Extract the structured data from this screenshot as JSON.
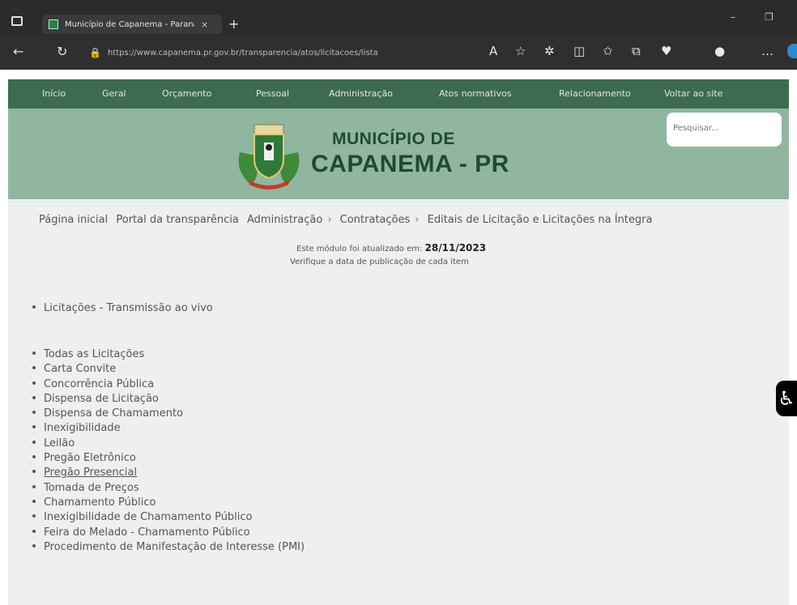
{
  "browser": {
    "tab_title": "Município de Capanema - Paraná",
    "tab_close": "×",
    "new_tab": "+",
    "url": "https://www.capanema.pr.gov.br/transparencia/atos/licitacoes/lista"
  },
  "site_nav": {
    "items": [
      "Início",
      "Geral",
      "Orçamento",
      "Pessoal",
      "Administração",
      "Atos normativos",
      "Relacionamento",
      "Voltar ao site"
    ]
  },
  "header": {
    "title_line1": "MUNICÍPIO DE",
    "title_line2": "CAPANEMA - PR",
    "search_placeholder": "Pesquisar..."
  },
  "breadcrumb": {
    "items": [
      "Página inicial",
      "Portal da transparência",
      "Administração",
      "Contratações",
      "Editais de Licitação e Licitações na Íntegra"
    ],
    "separator": "›"
  },
  "update_notice": {
    "prefix": "Este módulo foi atualizado em:",
    "date": "28/11/2023",
    "verify": "Verifique a data de publicação de cada item"
  },
  "live_list": [
    "Licitações - Transmissão ao vivo"
  ],
  "main_list": [
    "Todas as Licitações",
    "Carta Convite",
    "Concorrência Pública",
    "Dispensa de Licitação",
    "Dispensa de Chamamento",
    "Inexigibilidade",
    "Leilão",
    "Pregão Eletrônico",
    "Pregão Presencial",
    "Tomada de Preços",
    "Chamamento Público",
    "Inexigibilidade de Chamamento Público",
    "Feira do Melado - Chamamento Público",
    "Procedimento de Manifestação de Interesse (PMI)"
  ],
  "colors": {
    "nav_bg": "#3d6b4f",
    "header_bg": "#90b69f",
    "title": "#1f4a2d",
    "content_bg": "#edf0ef"
  },
  "icons": [
    "tabs-icon",
    "back-icon",
    "refresh-icon",
    "lock-icon",
    "read-aloud-icon",
    "favorite-icon",
    "extensions-icon",
    "split-screen-icon",
    "favorites-bar-icon",
    "collections-icon",
    "profile-icon",
    "more-icon",
    "accessibility-icon"
  ]
}
